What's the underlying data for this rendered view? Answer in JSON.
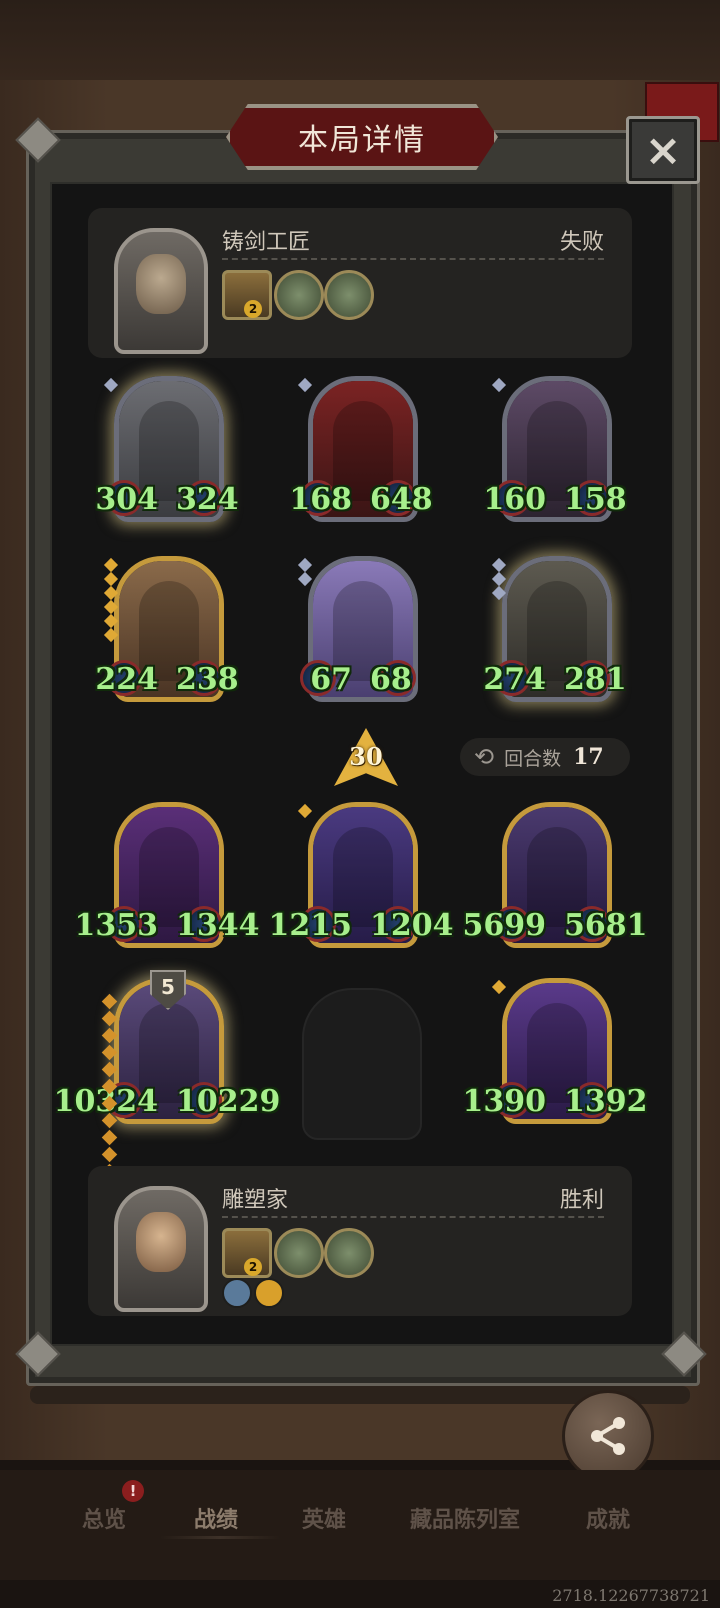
{
  "dialog": {
    "title": "本局详情",
    "close_label": "×"
  },
  "top_player": {
    "name": "铸剑工匠",
    "result": "失败",
    "relic_badge": "2"
  },
  "bottom_player": {
    "name": "雕塑家",
    "result": "胜利",
    "relic_badge": "2"
  },
  "opponent_board": [
    {
      "attack": "304",
      "health": "324"
    },
    {
      "attack": "168",
      "health": "648"
    },
    {
      "attack": "160",
      "health": "158"
    },
    {
      "attack": "224",
      "health": "238"
    },
    {
      "attack": "67",
      "health": "68"
    },
    {
      "attack": "274",
      "health": "281"
    }
  ],
  "player_board": [
    {
      "attack": "1353",
      "health": "1344"
    },
    {
      "attack": "1215",
      "health": "1204"
    },
    {
      "attack": "5699",
      "health": "5681"
    },
    {
      "attack": "10324",
      "health": "10229",
      "level": "5"
    },
    {
      "attack": "1390",
      "health": "1392"
    }
  ],
  "damage_badge": {
    "value": "30"
  },
  "round": {
    "label": "回合数",
    "value": "17"
  },
  "share": {
    "label": "分享"
  },
  "tabs": [
    {
      "label": "总览",
      "badge": "!"
    },
    {
      "label": "战绩"
    },
    {
      "label": "英雄"
    },
    {
      "label": "藏品陈列室"
    },
    {
      "label": "成就"
    }
  ],
  "version": "2718.12267738721",
  "icons": {
    "close": "close-icon",
    "share": "share-icon",
    "round": "repeat-icon"
  },
  "colors": {
    "stat_text": "#a7ef8c",
    "panel_bg": "#141414",
    "title_banner": "#5a1414",
    "gold_frame": "#c59a3c"
  }
}
